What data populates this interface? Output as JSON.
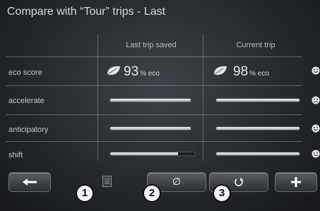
{
  "header": {
    "title": "Compare with “Tour” trips - Last"
  },
  "columns": {
    "last_trip": "Last trip saved",
    "current_trip": "Current trip"
  },
  "rows": [
    {
      "label": "eco score",
      "last": "93",
      "current": "98",
      "unit": "% eco",
      "smiley": "happy"
    },
    {
      "label": "accelerate",
      "last_level": 1.0,
      "current_level": 1.0,
      "smiley": "sad"
    },
    {
      "label": "anticipatory",
      "last_level": 1.0,
      "current_level": 1.0,
      "smiley": "happy"
    },
    {
      "label": "shift",
      "last_level": 0.8,
      "current_level": 1.0,
      "smiley": "happy"
    }
  ],
  "buttons": {
    "back": "left-arrow-icon",
    "average": "∅",
    "reset": "reset-icon",
    "add": "plus-icon"
  },
  "callouts": [
    "1",
    "2",
    "3"
  ],
  "colors": {
    "background": "#2a2d31",
    "text": "#d8dadd",
    "bar": "#e8eaec"
  }
}
